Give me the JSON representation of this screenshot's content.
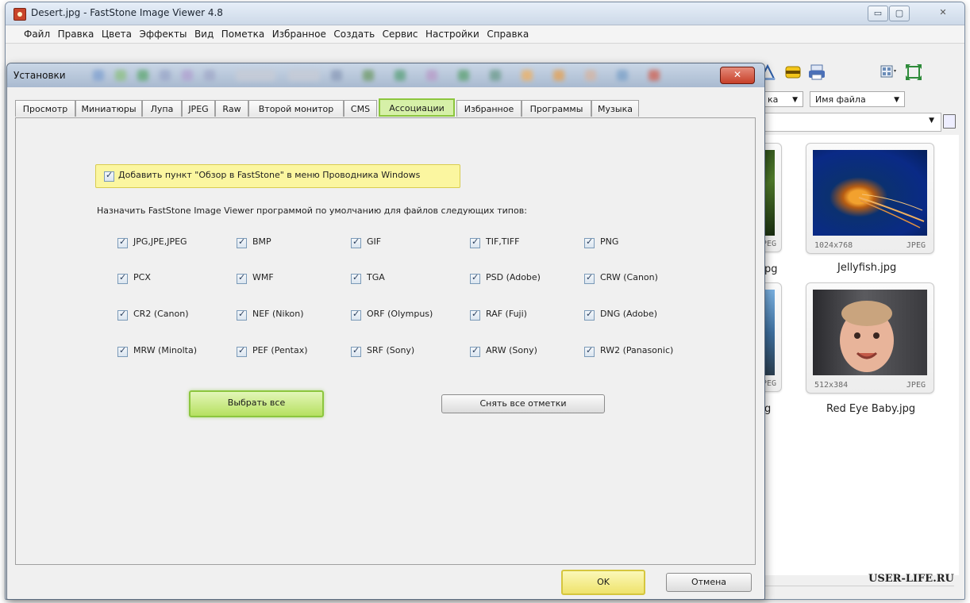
{
  "window": {
    "title": "Desert.jpg  -  FastStone Image Viewer 4.8"
  },
  "menu": [
    "Файл",
    "Правка",
    "Цвета",
    "Эффекты",
    "Вид",
    "Пометка",
    "Избранное",
    "Создать",
    "Сервис",
    "Настройки",
    "Справка"
  ],
  "browser": {
    "sort_combo1": "ка",
    "sort_combo2": "Имя файла",
    "thumbnails": [
      {
        "dims": "",
        "format": "PEG",
        "name": "pg"
      },
      {
        "dims": "1024x768",
        "format": "JPEG",
        "name": "Jellyfish.jpg"
      },
      {
        "dims": "",
        "format": "PEG",
        "name": "g"
      },
      {
        "dims": "512x384",
        "format": "JPEG",
        "name": "Red Eye Baby.jpg"
      }
    ],
    "watermark": "USER-LIFE.RU"
  },
  "dialog": {
    "title": "Установки",
    "close_label": "✕",
    "tabs": [
      "Просмотр",
      "Миниатюры",
      "Лупа",
      "JPEG",
      "Raw",
      "Второй монитор",
      "CMS",
      "Ассоциации",
      "Избранное",
      "Программы",
      "Музыка"
    ],
    "active_tab": "Ассоциации",
    "explorer_option": {
      "label": "Добавить пункт \"Обзор в FastStone\" в меню Проводника Windows",
      "checked": true
    },
    "assoc_caption": "Назначить FastStone Image Viewer программой по умолчанию для файлов следующих типов:",
    "file_types": [
      [
        "JPG,JPE,JPEG",
        "BMP",
        "GIF",
        "TIF,TIFF",
        "PNG"
      ],
      [
        "PCX",
        "WMF",
        "TGA",
        "PSD (Adobe)",
        "CRW (Canon)"
      ],
      [
        "CR2 (Canon)",
        "NEF (Nikon)",
        "ORF (Olympus)",
        "RAF (Fuji)",
        "DNG (Adobe)"
      ],
      [
        "MRW (Minolta)",
        "PEF (Pentax)",
        "SRF (Sony)",
        "ARW (Sony)",
        "RW2 (Panasonic)"
      ]
    ],
    "select_all": "Выбрать все",
    "clear_all": "Снять все отметки",
    "ok": "OK",
    "cancel": "Отмена"
  }
}
